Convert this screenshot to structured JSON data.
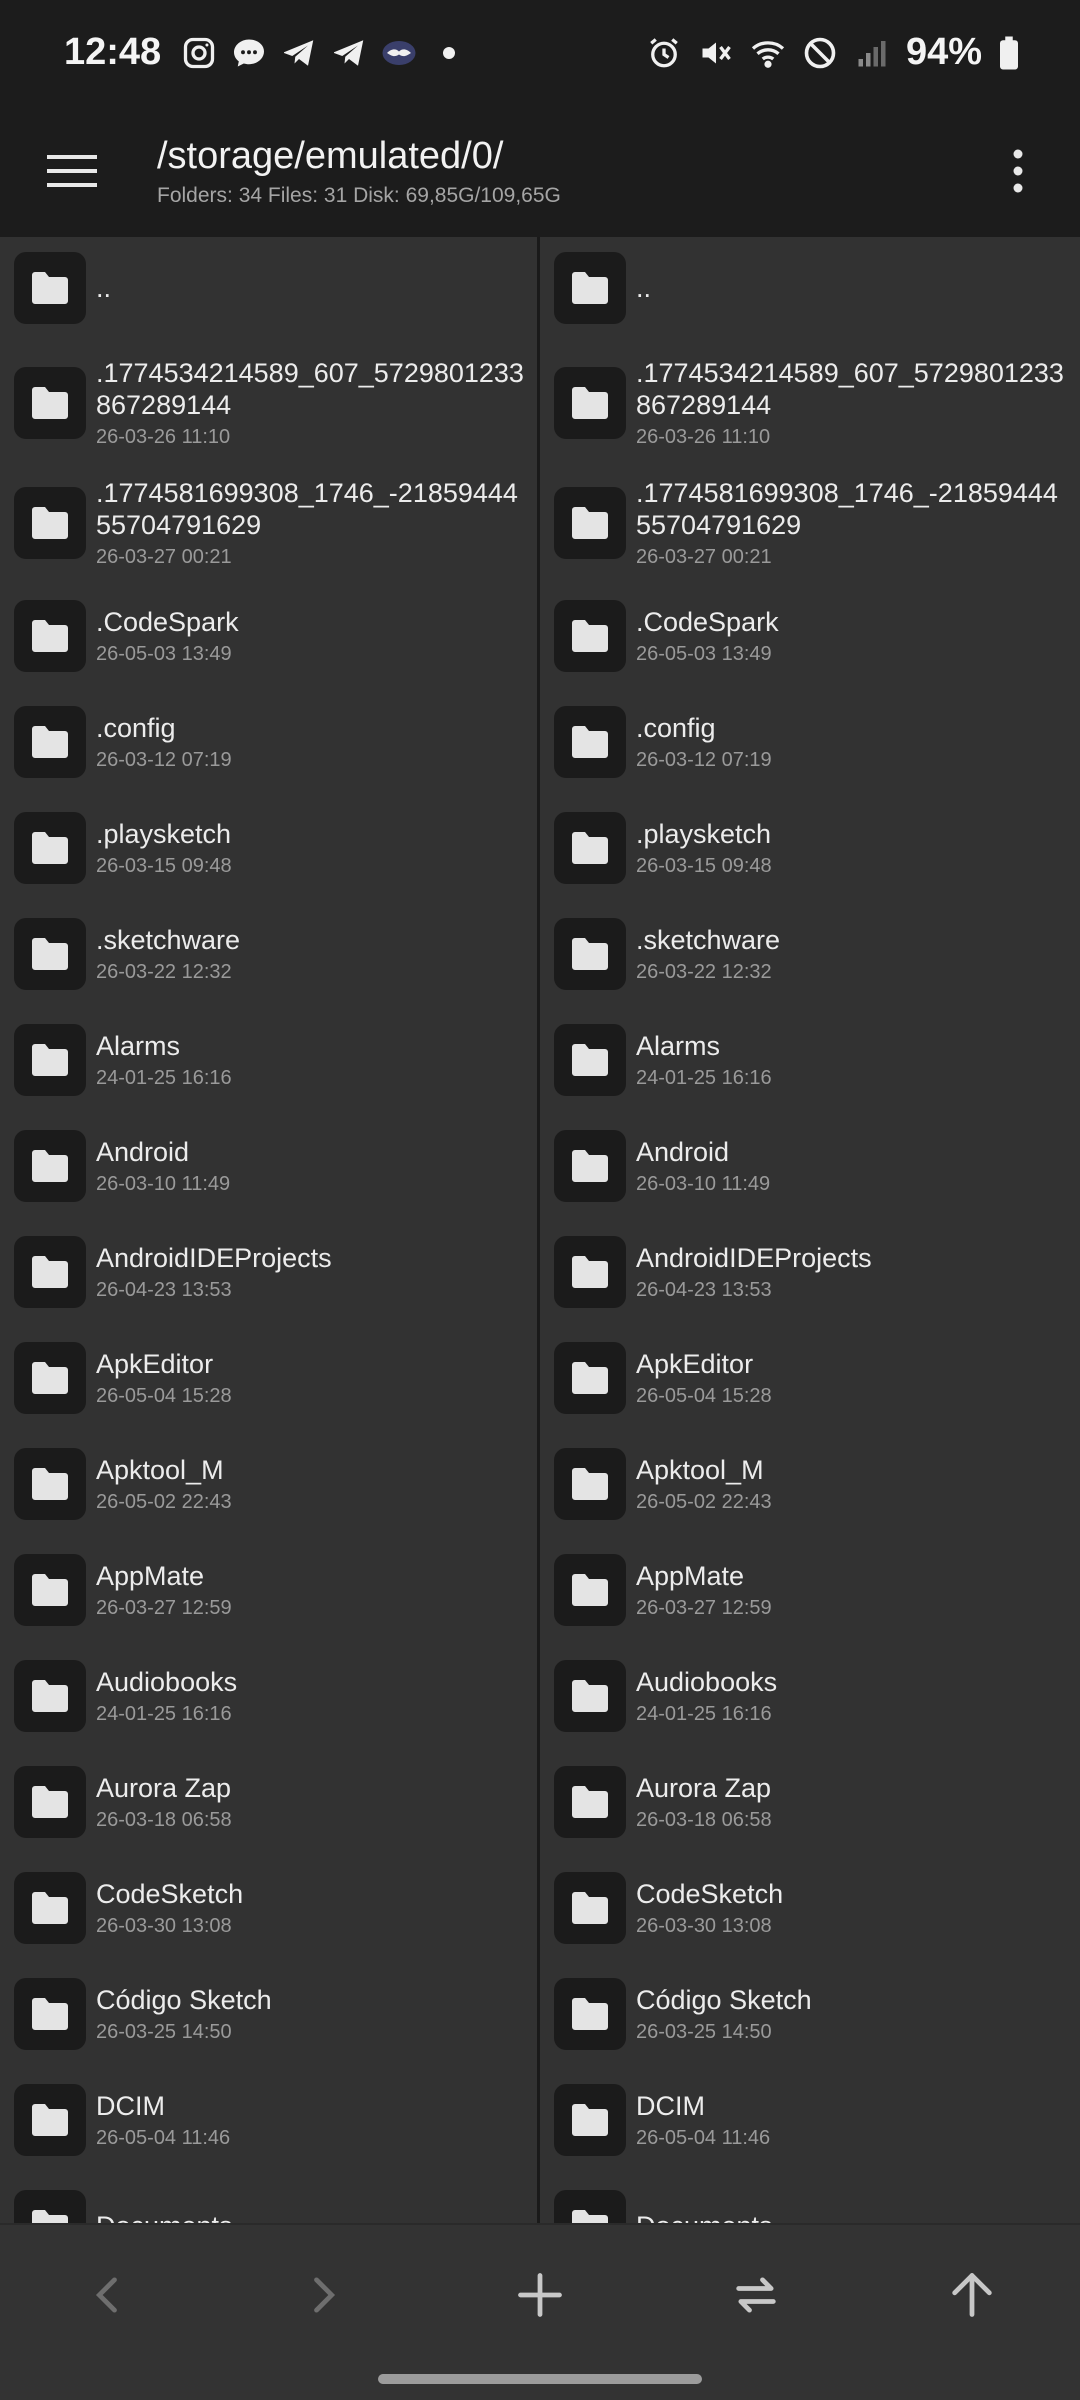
{
  "status_bar": {
    "time": "12:48",
    "battery": "94%",
    "left_icons": [
      "instagram-icon",
      "messages-icon",
      "telegram-icon",
      "telegram-icon",
      "handshake-app-icon",
      "notification-dot-icon"
    ],
    "right_icons": [
      "alarm-icon",
      "vibrate-mute-icon",
      "wifi-icon",
      "do-not-disturb-icon",
      "signal-icon",
      "battery-icon"
    ]
  },
  "app_bar": {
    "path": "/storage/emulated/0/",
    "stats": "Folders: 34  Files: 31  Disk: 69,85G/109,65G"
  },
  "files": [
    {
      "name": "..",
      "date": "",
      "kind": "parent"
    },
    {
      "name": ".1774534214589_607_5729801233867289144",
      "date": "26-03-26 11:10",
      "kind": "long"
    },
    {
      "name": ".1774581699308_1746_-2185944455704791629",
      "date": "26-03-27 00:21",
      "kind": "long"
    },
    {
      "name": ".CodeSpark",
      "date": "26-05-03 13:49",
      "kind": "std"
    },
    {
      "name": ".config",
      "date": "26-03-12 07:19",
      "kind": "std"
    },
    {
      "name": ".playsketch",
      "date": "26-03-15 09:48",
      "kind": "std"
    },
    {
      "name": ".sketchware",
      "date": "26-03-22 12:32",
      "kind": "std"
    },
    {
      "name": "Alarms",
      "date": "24-01-25 16:16",
      "kind": "std"
    },
    {
      "name": "Android",
      "date": "26-03-10 11:49",
      "kind": "std"
    },
    {
      "name": "AndroidIDEProjects",
      "date": "26-04-23 13:53",
      "kind": "std"
    },
    {
      "name": "ApkEditor",
      "date": "26-05-04 15:28",
      "kind": "std"
    },
    {
      "name": "Apktool_M",
      "date": "26-05-02 22:43",
      "kind": "std"
    },
    {
      "name": "AppMate",
      "date": "26-03-27 12:59",
      "kind": "std"
    },
    {
      "name": "Audiobooks",
      "date": "24-01-25 16:16",
      "kind": "std"
    },
    {
      "name": "Aurora Zap",
      "date": "26-03-18 06:58",
      "kind": "std"
    },
    {
      "name": "CodeSketch",
      "date": "26-03-30 13:08",
      "kind": "std"
    },
    {
      "name": "Código Sketch",
      "date": "26-03-25 14:50",
      "kind": "std"
    },
    {
      "name": "DCIM",
      "date": "26-05-04 11:46",
      "kind": "std"
    },
    {
      "name": "Documents",
      "date": "",
      "kind": "std"
    }
  ],
  "bottom_bar": {
    "buttons": [
      {
        "name": "back-button",
        "icon": "chevron-left-icon",
        "enabled": false
      },
      {
        "name": "forward-button",
        "icon": "chevron-right-icon",
        "enabled": false
      },
      {
        "name": "add-button",
        "icon": "plus-icon",
        "enabled": true
      },
      {
        "name": "swap-panes-button",
        "icon": "swap-icon",
        "enabled": true
      },
      {
        "name": "go-up-button",
        "icon": "arrow-up-icon",
        "enabled": true
      }
    ]
  },
  "colors": {
    "background": "#323232",
    "bar": "#1c1c1c",
    "folder_tile": "#1b1b1b",
    "text": "#ececec",
    "subtext": "#9a9a9a"
  }
}
